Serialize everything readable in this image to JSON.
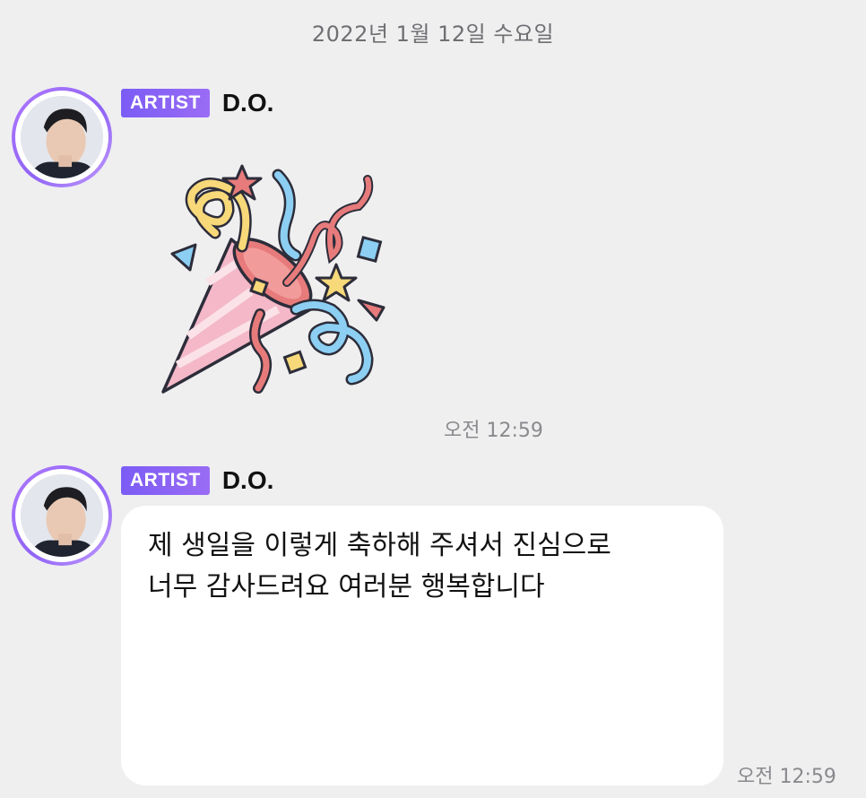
{
  "date_divider": "2022년 1월 12일 수요일",
  "messages": [
    {
      "badge": "ARTIST",
      "sender": "D.O.",
      "sticker": "party-popper-sticker",
      "time": "오전 12:59"
    },
    {
      "badge": "ARTIST",
      "sender": "D.O.",
      "lines": [
        "제 생일을 이렇게 축하해 주셔서 진심으로",
        "너무 감사드려요 여러분 행복합니다",
        "",
        "",
        "",
        ""
      ],
      "time": "오전 12:59"
    }
  ],
  "colors": {
    "background": "#efeff0",
    "badge": "#8a63f5",
    "avatar_ring": "#a06ef8",
    "bubble": "#ffffff",
    "timestamp": "#8a8a8e"
  }
}
